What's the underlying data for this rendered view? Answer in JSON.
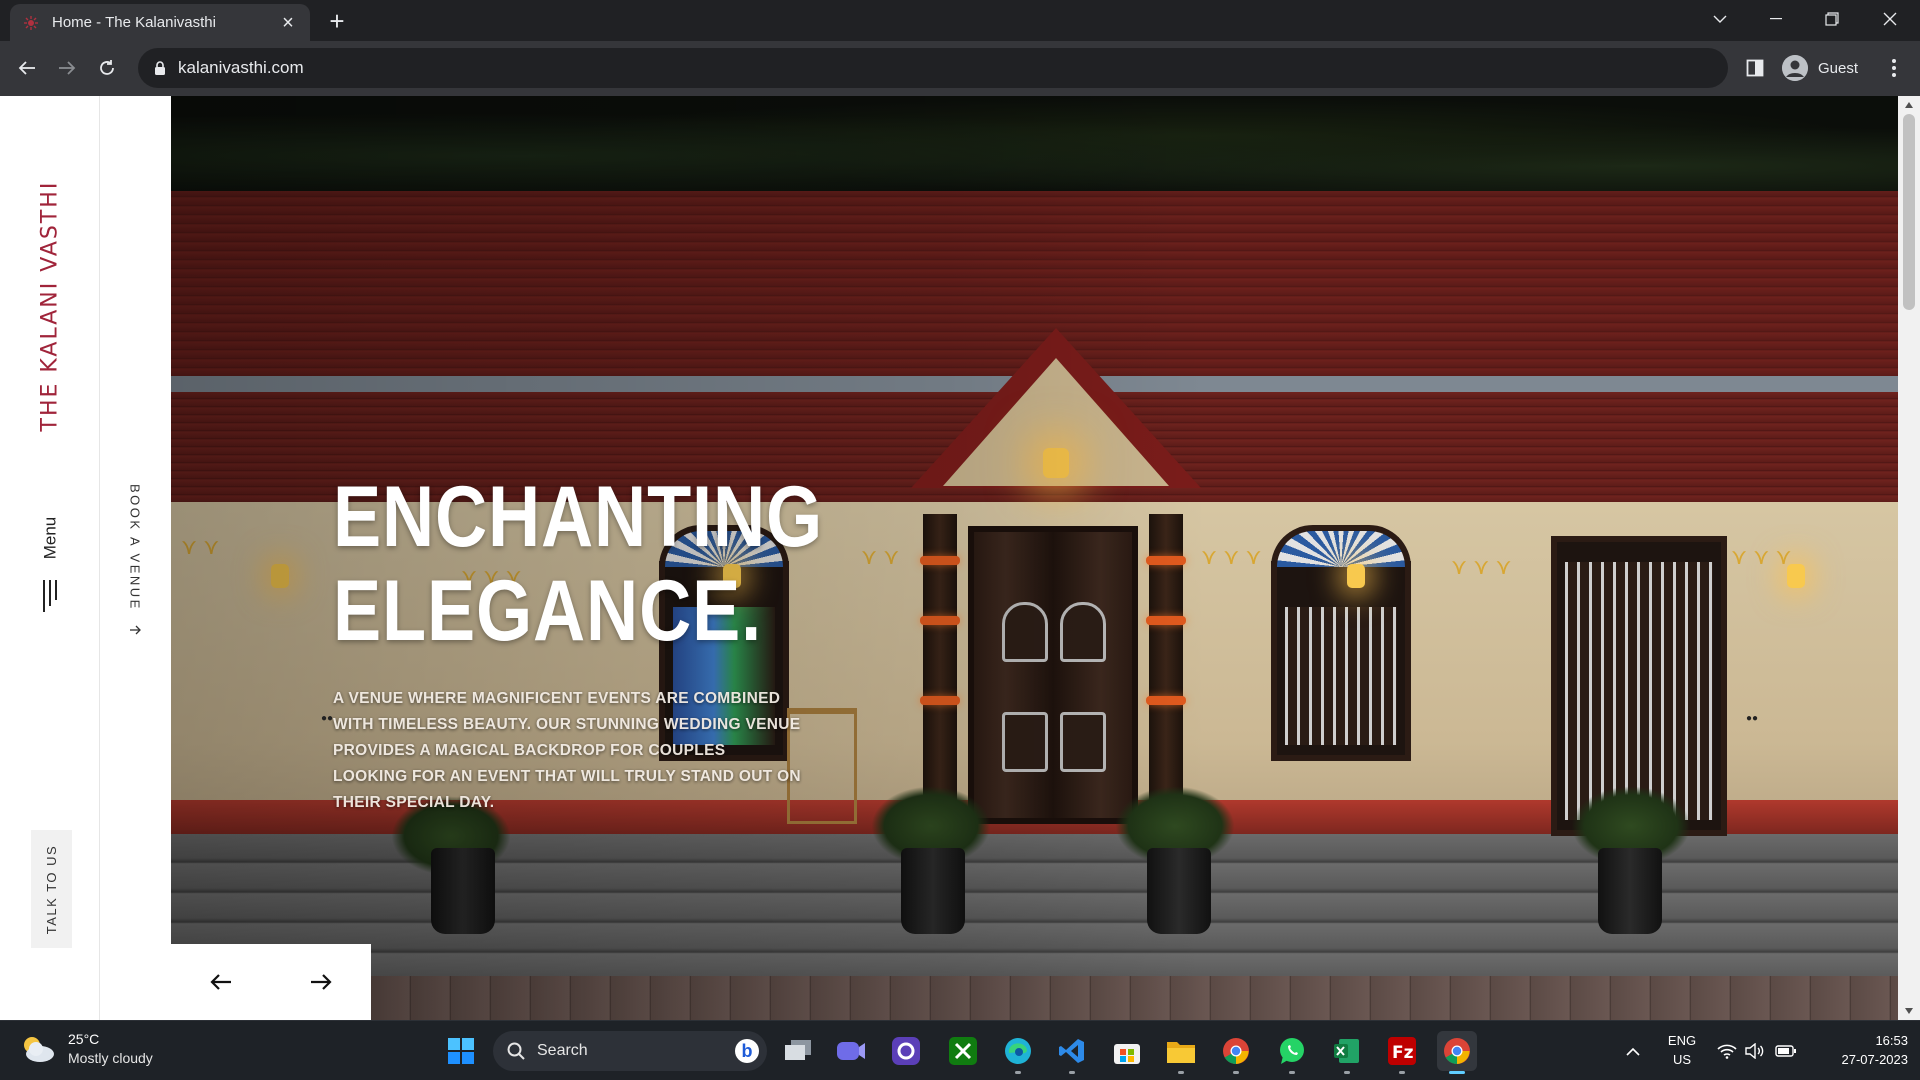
{
  "browser": {
    "tab_title": "Home - The Kalanivasthi",
    "url": "kalanivasthi.com",
    "profile_label": "Guest"
  },
  "site": {
    "brand": "THE KALANI VASTHI",
    "menu_label": "Menu",
    "book_label": "BOOK A VENUE",
    "book_arrow": "→",
    "talk_label": "TALK TO US",
    "hero_title_line1": "ENCHANTING",
    "hero_title_line2": "ELEGANCE.",
    "hero_subtitle": "A venue where magnificent events are combined with timeless beauty. Our stunning wedding venue provides a magical backdrop for couples looking for an event that will truly stand out on their special day.",
    "prev_arrow": "←",
    "next_arrow": "→",
    "brand_color": "#a0243a"
  },
  "taskbar": {
    "weather_temp": "25°C",
    "weather_condition": "Mostly cloudy",
    "search_placeholder": "Search",
    "lang_line1": "ENG",
    "lang_line2": "US",
    "time": "16:53",
    "date": "27-07-2023",
    "pinned_apps": [
      "start-icon",
      "search-icon",
      "bing-icon",
      "task-view-icon",
      "teams-icon",
      "clipchamp-icon",
      "xbox-icon",
      "edge-icon",
      "vscode-icon",
      "store-icon",
      "file-explorer-icon",
      "chrome-icon",
      "whatsapp-icon",
      "excel-icon",
      "filezilla-icon",
      "chrome-active-icon"
    ]
  }
}
